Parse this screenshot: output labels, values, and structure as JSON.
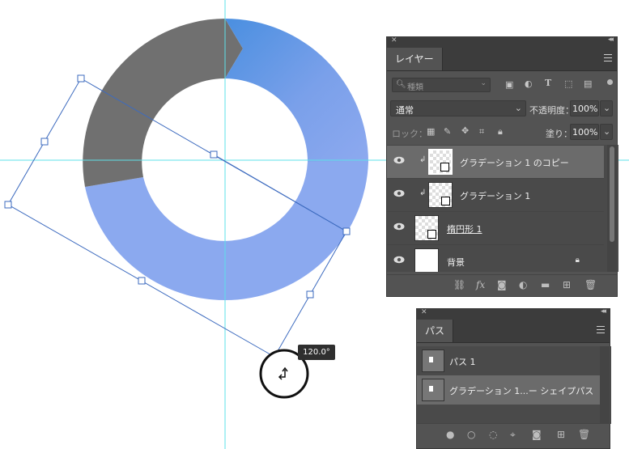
{
  "canvas": {
    "rotation_label": "120.0°",
    "colors": {
      "guide": "#5ee0e8",
      "ring_gray": "#6f6f6f",
      "ring_blue_light": "#8ba8ef",
      "ring_blue": "#4a90e2",
      "transform_box": "#3d6bbf"
    }
  },
  "layers_panel": {
    "title": "レイヤー",
    "search_placeholder": "種類",
    "blend_mode": "通常",
    "opacity_label": "不透明度：",
    "opacity_value": "100%",
    "lock_label": "ロック：",
    "fill_label": "塗り：",
    "fill_value": "100%",
    "layers": [
      {
        "name": "グラデーション 1 のコピー",
        "selected": true,
        "clipped": true,
        "type": "shape"
      },
      {
        "name": "グラデーション 1",
        "selected": false,
        "clipped": true,
        "type": "shape"
      },
      {
        "name": "楕円形 1",
        "selected": false,
        "clipped": false,
        "type": "shape"
      },
      {
        "name": "背景",
        "selected": false,
        "clipped": false,
        "type": "background",
        "locked": true
      }
    ],
    "footer_icons": [
      "link-icon",
      "fx-icon",
      "mask-icon",
      "adjustment-icon",
      "folder-icon",
      "new-layer-icon",
      "trash-icon"
    ]
  },
  "paths_panel": {
    "title": "パス",
    "paths": [
      {
        "name": "パス 1",
        "selected": false
      },
      {
        "name": "グラデーション 1...ー シェイプパス",
        "selected": true
      }
    ],
    "footer_icons": [
      "fill-path-icon",
      "stroke-path-icon",
      "selection-icon",
      "make-path-icon",
      "mask-icon",
      "new-path-icon",
      "trash-icon"
    ]
  }
}
